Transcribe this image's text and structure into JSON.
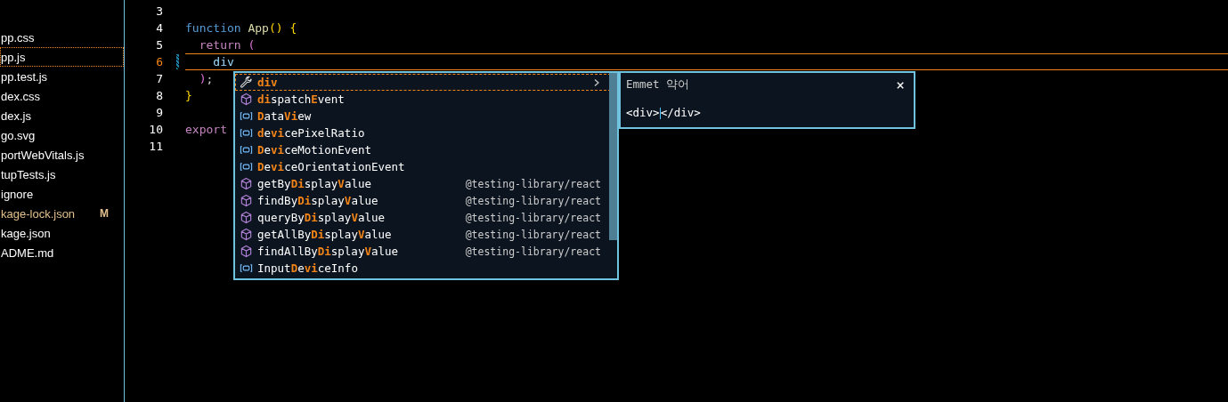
{
  "explorer": {
    "files": [
      {
        "name": "pp.css",
        "selected": false,
        "modified": false
      },
      {
        "name": "pp.js",
        "selected": true,
        "modified": false
      },
      {
        "name": "pp.test.js",
        "selected": false,
        "modified": false
      },
      {
        "name": "dex.css",
        "selected": false,
        "modified": false
      },
      {
        "name": "dex.js",
        "selected": false,
        "modified": false
      },
      {
        "name": "go.svg",
        "selected": false,
        "modified": false
      },
      {
        "name": "portWebVitals.js",
        "selected": false,
        "modified": false
      },
      {
        "name": "tupTests.js",
        "selected": false,
        "modified": false
      },
      {
        "name": "ignore",
        "selected": false,
        "modified": false
      },
      {
        "name": "kage-lock.json",
        "selected": false,
        "modified": true,
        "badge": "M"
      },
      {
        "name": "kage.json",
        "selected": false,
        "modified": false
      },
      {
        "name": "ADME.md",
        "selected": false,
        "modified": false
      }
    ]
  },
  "editor": {
    "lines": [
      {
        "number": "3",
        "current": false
      },
      {
        "number": "4",
        "current": false,
        "tokens": [
          {
            "text": "function",
            "kind": "keyword"
          },
          {
            "text": " App",
            "kind": "func"
          },
          {
            "text": "() {",
            "kind": "paren"
          }
        ]
      },
      {
        "number": "5",
        "current": false,
        "tokens": [
          {
            "text": "  return",
            "kind": "control"
          },
          {
            "text": " (",
            "kind": "bracket"
          }
        ]
      },
      {
        "number": "6",
        "current": true,
        "tokens": [
          {
            "text": "    div",
            "kind": "variable"
          }
        ]
      },
      {
        "number": "7",
        "current": false,
        "tokens": [
          {
            "text": "  )",
            "kind": "bracket"
          },
          {
            "text": ";",
            "kind": "plain"
          }
        ]
      },
      {
        "number": "8",
        "current": false,
        "tokens": [
          {
            "text": "}",
            "kind": "paren"
          }
        ]
      },
      {
        "number": "9",
        "current": false
      },
      {
        "number": "10",
        "current": false,
        "tokens": [
          {
            "text": "export",
            "kind": "control"
          }
        ]
      },
      {
        "number": "11",
        "current": false
      }
    ]
  },
  "suggestions": {
    "items": [
      {
        "kind": "snippet",
        "selected": true,
        "parts": [
          {
            "text": "div",
            "match": true
          }
        ]
      },
      {
        "kind": "method",
        "selected": false,
        "parts": [
          {
            "text": "di",
            "match": true
          },
          {
            "text": "spatch",
            "match": false
          },
          {
            "text": "E",
            "match": true
          },
          {
            "text": "vent",
            "match": false
          }
        ]
      },
      {
        "kind": "variable",
        "selected": false,
        "parts": [
          {
            "text": "D",
            "match": true
          },
          {
            "text": "ata",
            "match": false
          },
          {
            "text": "Vi",
            "match": true
          },
          {
            "text": "ew",
            "match": false
          }
        ]
      },
      {
        "kind": "variable",
        "selected": false,
        "parts": [
          {
            "text": "d",
            "match": true
          },
          {
            "text": "e",
            "match": false
          },
          {
            "text": "vi",
            "match": true
          },
          {
            "text": "cePixelRatio",
            "match": false
          }
        ]
      },
      {
        "kind": "variable",
        "selected": false,
        "parts": [
          {
            "text": "D",
            "match": true
          },
          {
            "text": "e",
            "match": false
          },
          {
            "text": "vi",
            "match": true
          },
          {
            "text": "ceMotionEvent",
            "match": false
          }
        ]
      },
      {
        "kind": "variable",
        "selected": false,
        "parts": [
          {
            "text": "D",
            "match": true
          },
          {
            "text": "e",
            "match": false
          },
          {
            "text": "vi",
            "match": true
          },
          {
            "text": "ceOrientationEvent",
            "match": false
          }
        ]
      },
      {
        "kind": "method",
        "selected": false,
        "parts": [
          {
            "text": "getBy",
            "match": false
          },
          {
            "text": "Di",
            "match": true
          },
          {
            "text": "splay",
            "match": false
          },
          {
            "text": "V",
            "match": true
          },
          {
            "text": "alue",
            "match": false
          }
        ],
        "source": "@testing-library/react"
      },
      {
        "kind": "method",
        "selected": false,
        "parts": [
          {
            "text": "findBy",
            "match": false
          },
          {
            "text": "Di",
            "match": true
          },
          {
            "text": "splay",
            "match": false
          },
          {
            "text": "V",
            "match": true
          },
          {
            "text": "alue",
            "match": false
          }
        ],
        "source": "@testing-library/react"
      },
      {
        "kind": "method",
        "selected": false,
        "parts": [
          {
            "text": "queryBy",
            "match": false
          },
          {
            "text": "Di",
            "match": true
          },
          {
            "text": "splay",
            "match": false
          },
          {
            "text": "V",
            "match": true
          },
          {
            "text": "alue",
            "match": false
          }
        ],
        "source": "@testing-library/react"
      },
      {
        "kind": "method",
        "selected": false,
        "parts": [
          {
            "text": "getAllBy",
            "match": false
          },
          {
            "text": "Di",
            "match": true
          },
          {
            "text": "splay",
            "match": false
          },
          {
            "text": "V",
            "match": true
          },
          {
            "text": "alue",
            "match": false
          }
        ],
        "source": "@testing-library/react"
      },
      {
        "kind": "method",
        "selected": false,
        "parts": [
          {
            "text": "findAllBy",
            "match": false
          },
          {
            "text": "Di",
            "match": true
          },
          {
            "text": "splay",
            "match": false
          },
          {
            "text": "V",
            "match": true
          },
          {
            "text": "alue",
            "match": false
          }
        ],
        "source": "@testing-library/react"
      },
      {
        "kind": "variable",
        "selected": false,
        "parts": [
          {
            "text": "Input",
            "match": false
          },
          {
            "text": "D",
            "match": true
          },
          {
            "text": "e",
            "match": false
          },
          {
            "text": "vi",
            "match": true
          },
          {
            "text": "ceInfo",
            "match": false
          }
        ]
      }
    ]
  },
  "details": {
    "title": "Emmet 약어",
    "close": "×",
    "preview_before": "<div>",
    "preview_after": "</div>"
  }
}
